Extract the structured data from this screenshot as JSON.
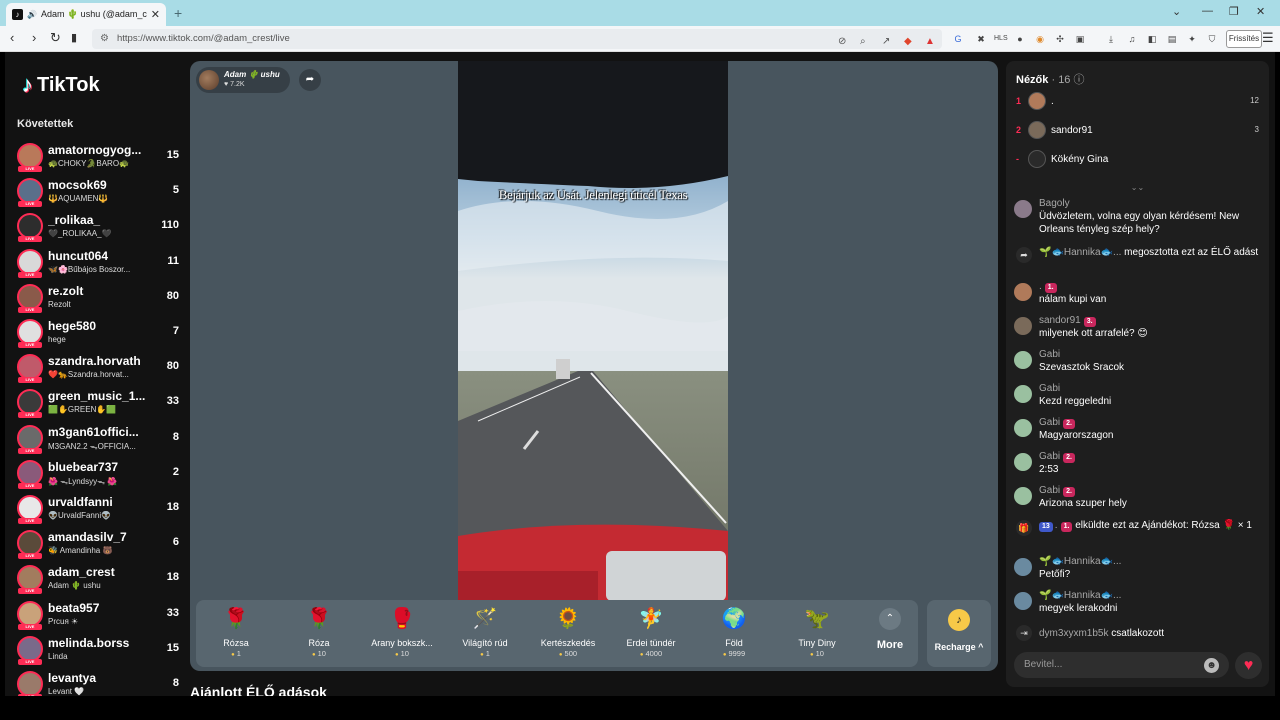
{
  "browser": {
    "tab_title": "Adam 🌵 ushu (@adam_crest",
    "url": "https://www.tiktok.com/@adam_crest/live",
    "refresh_label": "Frissítés"
  },
  "sidebar": {
    "logo": "TikTok",
    "following_heading": "Követettek",
    "live_label": "LIVE",
    "items": [
      {
        "name": "amatornogyog...",
        "sub": "🐢CHOKY🐊BARO🐢",
        "count": "15",
        "color": "#b9795a"
      },
      {
        "name": "mocsok69",
        "sub": "🔱AQUAMEN🔱",
        "count": "5",
        "color": "#5a6f8a"
      },
      {
        "name": "_rolikaa_",
        "sub": "🖤_ROLIKAA_🖤",
        "count": "110",
        "color": "#2d2d2d"
      },
      {
        "name": "huncut064",
        "sub": "🦋🌸Bűbájos Boszor...",
        "count": "11",
        "color": "#d9d9d9"
      },
      {
        "name": "re.zolt",
        "sub": "Rezolt",
        "count": "80",
        "color": "#8a5a4a"
      },
      {
        "name": "hege580",
        "sub": "hege",
        "count": "7",
        "color": "#e0e0e0"
      },
      {
        "name": "szandra.horvath",
        "sub": "❤️🐆Szandra.horvat...",
        "count": "80",
        "color": "#c05a6a"
      },
      {
        "name": "green_music_1...",
        "sub": "🟩✋GREEN✋🟩",
        "count": "33",
        "color": "#3a3a3a"
      },
      {
        "name": "m3gan61offici...",
        "sub": "M3GAN2.2 ᯓOFFICIA...",
        "count": "8",
        "color": "#6a6a6a"
      },
      {
        "name": "bluebear737",
        "sub": "🌺 ᯓLyndsyyᯓ 🌺",
        "count": "2",
        "color": "#8a5a7a"
      },
      {
        "name": "urvaldfanni",
        "sub": "👽UrvaldFanni👽",
        "count": "18",
        "color": "#e8e8e8"
      },
      {
        "name": "amandasilv_7",
        "sub": "🐝 Amandinha 🐻",
        "count": "6",
        "color": "#5a4a3a"
      },
      {
        "name": "adam_crest",
        "sub": "Adam 🌵 ushu",
        "count": "18",
        "color": "#a27c5e"
      },
      {
        "name": "beata957",
        "sub": "Рrсuя ☀",
        "count": "33",
        "color": "#c9a27a"
      },
      {
        "name": "melinda.borss",
        "sub": "Linda",
        "count": "15",
        "color": "#7a6a8a"
      },
      {
        "name": "levantya",
        "sub": "Levant 🤍",
        "count": "8",
        "color": "#9a7a6a"
      }
    ]
  },
  "stream": {
    "host_name": "Adam 🌵 ushu",
    "host_likes": "♥ 7.2K",
    "caption": "Bejárjuk az Usát. Jelenlegi úticél Texas"
  },
  "gifts": [
    {
      "name": "Rózsa",
      "price": "1",
      "icon": "rose-icon",
      "glyph": "🌹"
    },
    {
      "name": "Róza",
      "price": "10",
      "icon": "rose-icon",
      "glyph": "🌹"
    },
    {
      "name": "Arany bokszk...",
      "price": "10",
      "icon": "golden-glove-icon",
      "glyph": "🥊"
    },
    {
      "name": "Világító rúd",
      "price": "1",
      "icon": "light-stick-icon",
      "glyph": "🪄"
    },
    {
      "name": "Kertészkedés",
      "price": "500",
      "icon": "gardening-icon",
      "glyph": "🌻"
    },
    {
      "name": "Erdei tündér",
      "price": "4000",
      "icon": "fairy-icon",
      "glyph": "🧚"
    },
    {
      "name": "Föld",
      "price": "9999",
      "icon": "earth-icon",
      "glyph": "🌍"
    },
    {
      "name": "Tiny Diny",
      "price": "10",
      "icon": "dinosaur-icon",
      "glyph": "🦖"
    }
  ],
  "more_label": "More",
  "recharge_label": "Recharge ^",
  "recommended_heading": "Ajánlott ÉLŐ adások",
  "viewers": {
    "heading": "Nézők",
    "count": "· 16",
    "top": [
      {
        "rank": "1",
        "name": ".",
        "score": "12",
        "color": "#b07a5a"
      },
      {
        "rank": "2",
        "name": "sandor91",
        "score": "3",
        "color": "#7a6a5a"
      },
      {
        "rank": "-",
        "name": "Kökény Gina",
        "score": "",
        "color": "#2a2a2a"
      }
    ]
  },
  "chat": [
    {
      "user": "Bagoly",
      "badge": "",
      "text": "Üdvözletem, volna egy olyan kérdésem! New Orleans tényleg szép hely?",
      "color": "#8a7a8a"
    },
    {
      "user": "🌱🐟Hannika🐟...",
      "badge": "",
      "text": "megosztotta ezt az ÉLŐ adást",
      "color": "",
      "type": "share"
    },
    {
      "user": ".",
      "badge": "1.",
      "text": "nálam kupi van",
      "color": "#b07a5a"
    },
    {
      "user": "sandor91",
      "badge": "3.",
      "text": "milyenek ott arrafelé? 😊",
      "color": "#7a6a5a"
    },
    {
      "user": "Gabi",
      "badge": "",
      "text": "Szevasztok Sracok",
      "color": "#9ac0a0"
    },
    {
      "user": "Gabi",
      "badge": "",
      "text": "Kezd reggeledni",
      "color": "#9ac0a0"
    },
    {
      "user": "Gabi",
      "badge": "2.",
      "text": "Magyarorszagon",
      "color": "#9ac0a0"
    },
    {
      "user": "Gabi",
      "badge": "2.",
      "text": "2:53",
      "color": "#9ac0a0"
    },
    {
      "user": "Gabi",
      "badge": "2.",
      "text": "Arizona szuper hely",
      "color": "#9ac0a0"
    },
    {
      "user": ".",
      "badge": "1.",
      "level": "13",
      "text": "elküldte ezt az Ajándékot: Rózsa 🌹 × 1",
      "color": "",
      "type": "gift"
    },
    {
      "user": "🌱🐟Hannika🐟...",
      "badge": "",
      "text": "Petőfi?",
      "color": "#6a8aa0"
    },
    {
      "user": "🌱🐟Hannika🐟...",
      "badge": "",
      "text": "megyek lerakodni",
      "color": "#6a8aa0"
    },
    {
      "user": "dym3xyxm1b5k",
      "badge": "",
      "text": "csatlakozott",
      "color": "",
      "type": "join"
    }
  ],
  "chat_input_placeholder": "Bevitel..."
}
